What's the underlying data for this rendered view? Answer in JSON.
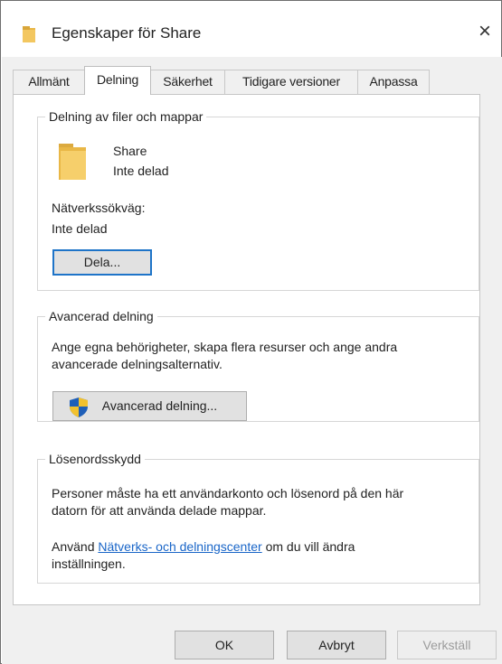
{
  "window": {
    "title": "Egenskaper för Share",
    "close_glyph": "×",
    "icon": "folder-icon"
  },
  "tabs": [
    {
      "label": "Allmänt",
      "active": false
    },
    {
      "label": "Delning",
      "active": true
    },
    {
      "label": "Säkerhet",
      "active": false
    },
    {
      "label": "Tidigare versioner",
      "active": false
    },
    {
      "label": "Anpassa",
      "active": false
    }
  ],
  "sharing": {
    "group_title": "Delning av filer och mappar",
    "folder_name": "Share",
    "folder_status": "Inte delad",
    "network_path_label": "Nätverkssökväg:",
    "network_path_value": "Inte delad",
    "share_button": "Dela..."
  },
  "advanced": {
    "group_title": "Avancerad delning",
    "description_line1": "Ange egna behörigheter, skapa flera resurser och ange andra",
    "description_line2": "avancerade delningsalternativ.",
    "button": "Avancerad delning..."
  },
  "password": {
    "group_title": "Lösenordsskydd",
    "description_line1": "Personer måste ha ett användarkonto och lösenord på den här",
    "description_line2": "datorn för att använda delade mappar.",
    "use_prefix": "Använd ",
    "link_text": "Nätverks- och delningscenter",
    "use_suffix": " om du vill ändra",
    "use_line2": "inställningen."
  },
  "footer": {
    "ok": "OK",
    "cancel": "Avbryt",
    "apply": "Verkställ"
  },
  "colors": {
    "accent": "#1e74c8",
    "link": "#1a66c8",
    "folder": "#f3c760",
    "shield_blue": "#1f5fb8",
    "shield_yellow": "#f2c12e"
  }
}
